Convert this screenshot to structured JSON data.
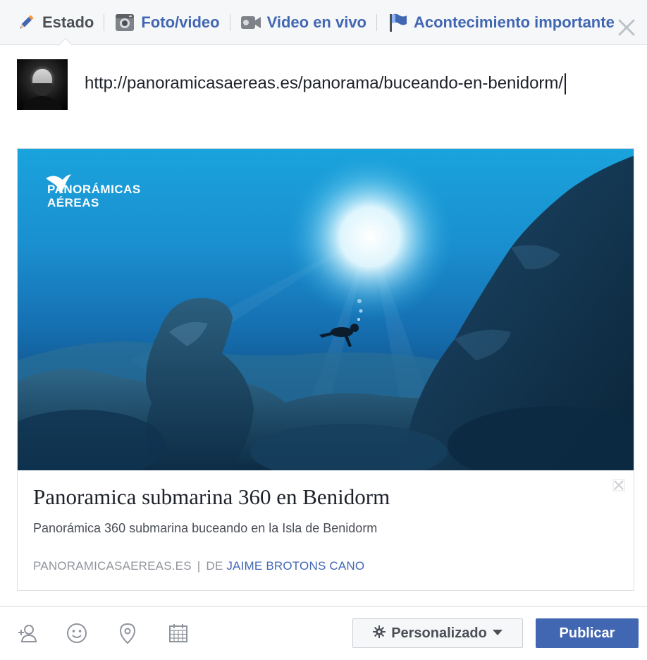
{
  "tabs": [
    {
      "label": "Estado",
      "icon": "pencil-icon",
      "active": true
    },
    {
      "label": "Foto/video",
      "icon": "camera-icon",
      "active": false
    },
    {
      "label": "Video en vivo",
      "icon": "video-camera-icon",
      "active": false
    },
    {
      "label": "Acontecimiento importante",
      "icon": "flag-icon",
      "active": false
    }
  ],
  "composer": {
    "text": "http://panoramicasaereas.es/panorama/buceando-en-benidorm/"
  },
  "preview": {
    "brand_line1": "PANORÁMICAS",
    "brand_line2": "AÉREAS",
    "title": "Panoramica submarina 360 en Benidorm",
    "description": "Panorámica 360 submarina buceando en la Isla de Benidorm",
    "domain": "PANORAMICASAEREAS.ES",
    "separator": "|",
    "by": "DE",
    "author": "JAIME BROTONS CANO"
  },
  "footer": {
    "icons": [
      "tag-friends-icon",
      "feeling-icon",
      "location-icon",
      "calendar-icon"
    ],
    "privacy_label": "Personalizado",
    "publish_label": "Publicar"
  },
  "colors": {
    "accent": "#4267b2",
    "header_bg": "#f6f7f9",
    "border": "#dddfe2",
    "muted_text": "#90949c"
  }
}
